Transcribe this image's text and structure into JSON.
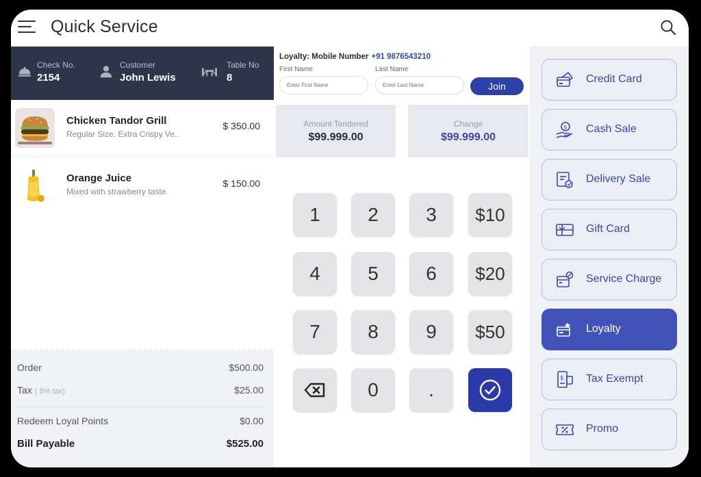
{
  "app": {
    "title": "Quick Service"
  },
  "order_header": {
    "check_label": "Check No.",
    "check_value": "2154",
    "customer_label": "Customer",
    "customer_value": "John Lewis",
    "table_label": "Table No",
    "table_value": "8"
  },
  "items": [
    {
      "name": "Chicken Tandor Grill",
      "description": "Regular Size, Extra Crispy Ve..",
      "price": "$ 350.00"
    },
    {
      "name": "Orange Juice",
      "description": "Mixed with strawberry taste",
      "price": "$ 150.00"
    }
  ],
  "totals": {
    "order_label": "Order",
    "order_value": "$500.00",
    "tax_label": "Tax",
    "tax_note": "( 5% tax)",
    "tax_value": "$25.00",
    "redeem_label": "Redeem Loyal Points",
    "redeem_value": "$0.00",
    "bill_label": "Bill Payable",
    "bill_value": "$525.00"
  },
  "loyalty": {
    "label": "Loyalty: Mobile Number",
    "phone": "+91 9876543210",
    "first_name_label": "First Name",
    "first_name_placeholder": "Enter First Name",
    "last_name_label": "Last Name",
    "last_name_placeholder": "Enter Last Name",
    "join_label": "Join"
  },
  "amounts": {
    "tendered_label": "Amount Tendered",
    "tendered_value": "$99.999.00",
    "change_label": "Change",
    "change_value": "$99.999.00"
  },
  "keypad": [
    "1",
    "2",
    "3",
    "$10",
    "4",
    "5",
    "6",
    "$20",
    "7",
    "8",
    "9",
    "$50",
    "",
    "0",
    ".",
    ""
  ],
  "payment_methods": [
    {
      "label": "Credit Card",
      "icon": "credit-card-icon"
    },
    {
      "label": "Cash Sale",
      "icon": "cash-icon"
    },
    {
      "label": "Delivery Sale",
      "icon": "delivery-icon"
    },
    {
      "label": "Gift Card",
      "icon": "gift-card-icon"
    },
    {
      "label": "Service Charge",
      "icon": "service-charge-icon"
    },
    {
      "label": "Loyalty",
      "icon": "loyalty-icon"
    },
    {
      "label": "Tax Exempt",
      "icon": "tax-exempt-icon"
    },
    {
      "label": "Promo",
      "icon": "promo-icon"
    }
  ],
  "active_payment": "Loyalty",
  "colors": {
    "header_dark": "#2c3549",
    "accent": "#2d3fa8",
    "active_button": "#4152b8",
    "change_value": "#3849a8"
  }
}
